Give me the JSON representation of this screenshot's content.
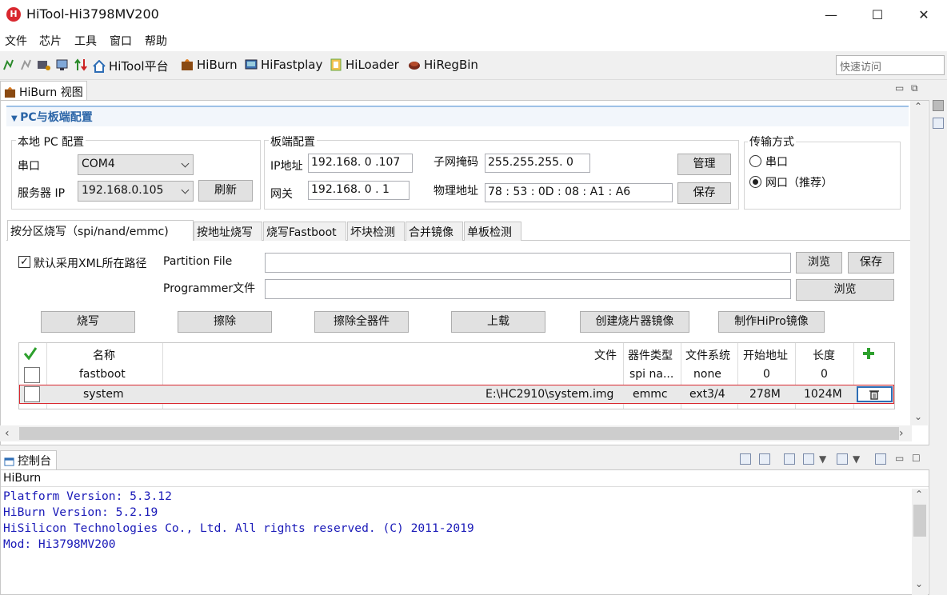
{
  "window": {
    "title": "HiTool-Hi3798MV200",
    "app_icon": "hitool-logo-icon",
    "minimize": "—",
    "maximize": "☐",
    "close": "✕"
  },
  "menu": [
    "文件",
    "芯片",
    "工具",
    "窗口",
    "帮助"
  ],
  "toolbar": {
    "tools": [
      {
        "label": "HiTool平台",
        "icon": "home-icon"
      },
      {
        "label": "HiBurn",
        "icon": "hiburn-icon"
      },
      {
        "label": "HiFastplay",
        "icon": "hifastplay-icon"
      },
      {
        "label": "HiLoader",
        "icon": "hiloader-icon"
      },
      {
        "label": "HiRegBin",
        "icon": "hiregbin-icon"
      }
    ],
    "quick_access_placeholder": "快速访问"
  },
  "view": {
    "tab_label": "HiBurn 视图",
    "section_title": "PC与板端配置"
  },
  "local_pc": {
    "group_label": "本地 PC 配置",
    "port_label": "串口",
    "port_value": "COM4",
    "server_ip_label": "服务器 IP",
    "server_ip_value": "192.168.0.105",
    "refresh_label": "刷新"
  },
  "board": {
    "group_label": "板端配置",
    "ip_label": "IP地址",
    "ip_value": "192.168.  0 .107",
    "gateway_label": "网关",
    "gateway_value": "192.168.  0 .  1",
    "mask_label": "子网掩码",
    "mask_value": "255.255.255.  0",
    "mac_label": "物理地址",
    "mac_value": "78 : 53 : 0D : 08 : A1 : A6",
    "manage_label": "管理",
    "save_label": "保存"
  },
  "transfer": {
    "group_label": "传输方式",
    "serial_label": "串口",
    "net_label": "网口（推荐）",
    "selected": "net"
  },
  "func_tabs": [
    "按分区烧写（spi/nand/emmc)",
    "按地址烧写",
    "烧写Fastboot",
    "坏块检测",
    "合并镜像",
    "单板检测"
  ],
  "partition": {
    "use_xml_path_label": "默认采用XML所在路径",
    "use_xml_path_checked": true,
    "partition_file_label": "Partition File",
    "partition_file_value": "",
    "programmer_label": "Programmer文件",
    "programmer_value": "",
    "browse_label": "浏览",
    "save_label": "保存"
  },
  "actions": [
    "烧写",
    "擦除",
    "擦除全器件",
    "上载",
    "创建烧片器镜像",
    "制作HiPro镜像"
  ],
  "table": {
    "headers": {
      "name": "名称",
      "file": "文件",
      "device": "器件类型",
      "fs": "文件系统",
      "start": "开始地址",
      "length": "长度"
    },
    "rows": [
      {
        "name": "fastboot",
        "file": "",
        "device": "spi na...",
        "fs": "none",
        "start": "0",
        "length": "0"
      },
      {
        "name": "system",
        "file": "E:\\HC2910\\system.img",
        "device": "emmc",
        "fs": "ext3/4",
        "start": "278M",
        "length": "1024M"
      }
    ]
  },
  "console": {
    "tab_label": "控制台",
    "header": "HiBurn",
    "lines": [
      "Platform Version: 5.3.12",
      "HiBurn Version: 5.2.19",
      "HiSilicon Technologies Co., Ltd. All rights reserved. (C) 2011-2019",
      "Mod: Hi3798MV200"
    ]
  },
  "colors": {
    "accent": "#2a64a7",
    "console_text": "#1a1ab8",
    "selected_row_border": "#d9282f",
    "check_green": "#2ea02e"
  }
}
